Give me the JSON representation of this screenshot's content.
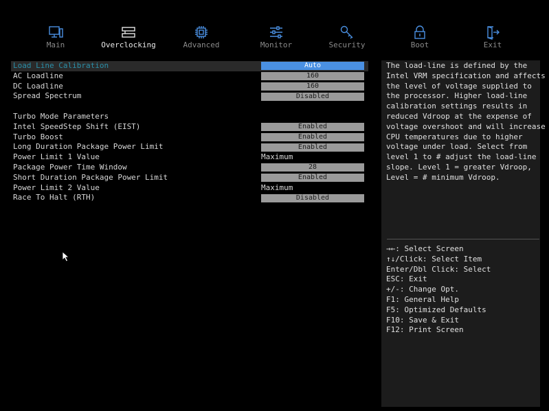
{
  "nav": {
    "tabs": [
      {
        "label": "Main",
        "icon": "computer-icon"
      },
      {
        "label": "Overclocking",
        "icon": "overclocking-icon",
        "active": true
      },
      {
        "label": "Advanced",
        "icon": "chip-icon"
      },
      {
        "label": "Monitor",
        "icon": "sliders-icon"
      },
      {
        "label": "Security",
        "icon": "key-icon"
      },
      {
        "label": "Boot",
        "icon": "lock-icon"
      },
      {
        "label": "Exit",
        "icon": "exit-door-icon"
      }
    ],
    "accent_color": "#4a90e2"
  },
  "settings": {
    "load_line_calibration": {
      "label": "Load Line Calibration",
      "value": "Auto"
    },
    "ac_loadline": {
      "label": "AC Loadline",
      "value": "160"
    },
    "dc_loadline": {
      "label": "DC Loadline",
      "value": "160"
    },
    "spread_spectrum": {
      "label": "Spread Spectrum",
      "value": "Disabled"
    },
    "turbo_header": {
      "label": "Turbo Mode Parameters"
    },
    "speedstep": {
      "label": "Intel SpeedStep Shift (EIST)",
      "value": "Enabled"
    },
    "turbo_boost": {
      "label": "Turbo Boost",
      "value": "Enabled"
    },
    "long_duration": {
      "label": "Long Duration Package Power Limit",
      "value": "Enabled"
    },
    "power_limit_1": {
      "label": "Power Limit 1 Value",
      "value": "Maximum"
    },
    "power_time_window": {
      "label": "Package Power Time Window",
      "value": "28"
    },
    "short_duration": {
      "label": "Short Duration Package Power Limit",
      "value": "Enabled"
    },
    "power_limit_2": {
      "label": "Power Limit 2 Value",
      "value": "Maximum"
    },
    "race_to_halt": {
      "label": "Race To Halt (RTH)",
      "value": "Disabled"
    }
  },
  "help": {
    "text": "The load-line is defined by the\nIntel VRM specification and affects\nthe level of voltage supplied to\nthe processor. Higher load-line\ncalibration settings results in\nreduced Vdroop at the expense of\nvoltage overshoot and will increase\nCPU temperatures due to higher\nvoltage under load. Select from\nlevel 1 to # adjust the load-line\nslope. Level 1 = greater Vdroop,\nLevel = # minimum Vdroop.",
    "keys": [
      "→←: Select Screen",
      "↑↓/Click: Select Item",
      "Enter/Dbl Click: Select",
      "ESC: Exit",
      "+/-: Change Opt.",
      "F1: General Help",
      "F5: Optimized Defaults",
      "F10: Save & Exit",
      "F12: Print Screen"
    ]
  }
}
